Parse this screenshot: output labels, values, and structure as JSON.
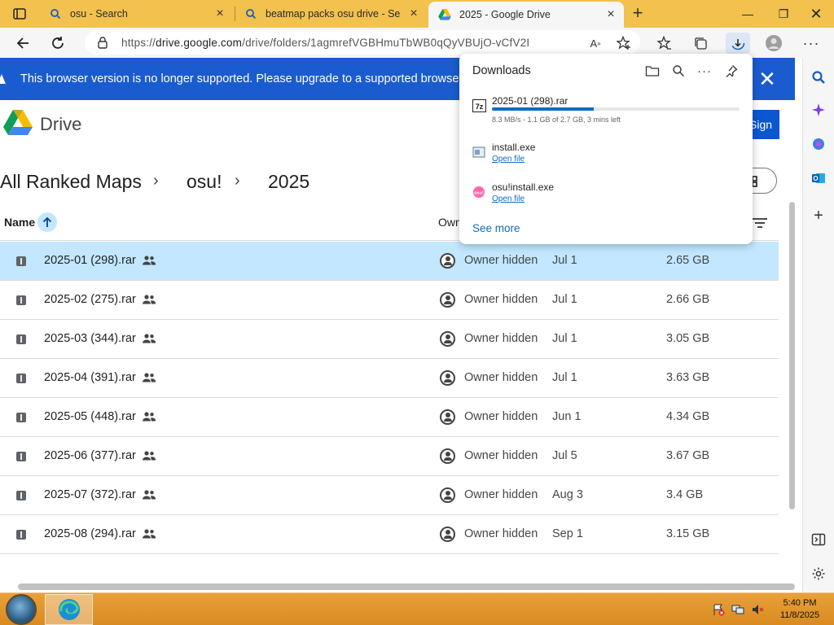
{
  "browser": {
    "tabs": [
      {
        "title": "osu - Search",
        "favicon": "search-icon",
        "active": false
      },
      {
        "title": "beatmap packs osu drive - Search",
        "favicon": "search-icon",
        "active": false
      },
      {
        "title": "2025 - Google Drive",
        "favicon": "google-drive-icon",
        "active": true
      }
    ],
    "address": {
      "scheme": "https://",
      "host": "drive.google.com",
      "path": "/drive/folders/1agmrefVGBHmuTbWB0qQyVBUjO-vCfV2I"
    }
  },
  "banner": {
    "text": "This browser version is no longer supported. Please upgrade to a supported browser."
  },
  "drive": {
    "app_name": "Drive",
    "signin_label": "Sign in",
    "breadcrumb": [
      "All Ranked Maps",
      "osu!",
      "2025"
    ],
    "columns": {
      "name": "Name",
      "owner": "Owner"
    },
    "files": [
      {
        "name": "2025-01 (298).rar",
        "owner": "Owner hidden",
        "date": "Jul 1",
        "size": "2.65 GB",
        "selected": true
      },
      {
        "name": "2025-02 (275).rar",
        "owner": "Owner hidden",
        "date": "Jul 1",
        "size": "2.66 GB",
        "selected": false
      },
      {
        "name": "2025-03 (344).rar",
        "owner": "Owner hidden",
        "date": "Jul 1",
        "size": "3.05 GB",
        "selected": false
      },
      {
        "name": "2025-04 (391).rar",
        "owner": "Owner hidden",
        "date": "Jul 1",
        "size": "3.63 GB",
        "selected": false
      },
      {
        "name": "2025-05 (448).rar",
        "owner": "Owner hidden",
        "date": "Jun 1",
        "size": "4.34 GB",
        "selected": false
      },
      {
        "name": "2025-06 (377).rar",
        "owner": "Owner hidden",
        "date": "Jul 5",
        "size": "3.67 GB",
        "selected": false
      },
      {
        "name": "2025-07 (372).rar",
        "owner": "Owner hidden",
        "date": "Aug 3",
        "size": "3.4 GB",
        "selected": false
      },
      {
        "name": "2025-08 (294).rar",
        "owner": "Owner hidden",
        "date": "Sep 1",
        "size": "3.15 GB",
        "selected": false
      }
    ]
  },
  "downloads": {
    "title": "Downloads",
    "items": [
      {
        "name": "2025-01 (298).rar",
        "status": "8.3 MB/s - 1.1 GB of 2.7 GB, 3 mins left",
        "progress": 0.41,
        "icon": "archive-icon"
      },
      {
        "name": "install.exe",
        "link": "Open file",
        "icon": "exe-icon"
      },
      {
        "name": "osu!install.exe",
        "link": "Open file",
        "icon": "osu-icon"
      }
    ],
    "see_more": "See more"
  },
  "taskbar": {
    "time": "5:40 PM",
    "date": "11/8/2025"
  },
  "colors": {
    "tabstrip": "#f2c14e",
    "banner": "#1a5ccf",
    "selected_row": "#c2e7ff",
    "accent": "#0b57d0",
    "download_progress": "#0f6cbd",
    "taskbar": "#e09528"
  }
}
